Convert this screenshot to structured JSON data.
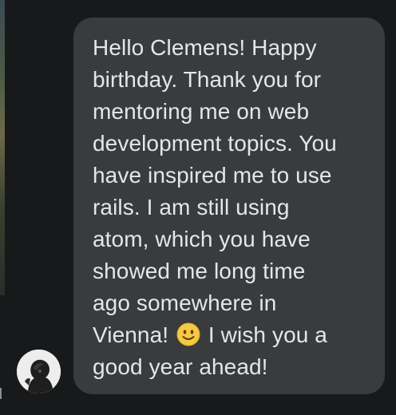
{
  "conversation": {
    "message": {
      "text_before_emoji": "Hello Clemens! Happy\nbirthday. Thank you for\nmentoring me on web\ndevelopment topics. You\nhave inspired me to use\nrails. I am still using\natom, which you have\nshowed me long time\nago somewhere in\nVienna! ",
      "emoji": "slightly-smiling-face-icon",
      "text_after_emoji": " I wish you a\ngood year ahead!"
    },
    "sender_avatar": "avatar"
  },
  "colors": {
    "background": "#18191a",
    "bubble": "#3a3b3c",
    "text": "#e4e6eb",
    "emoji": "#f7c842"
  }
}
